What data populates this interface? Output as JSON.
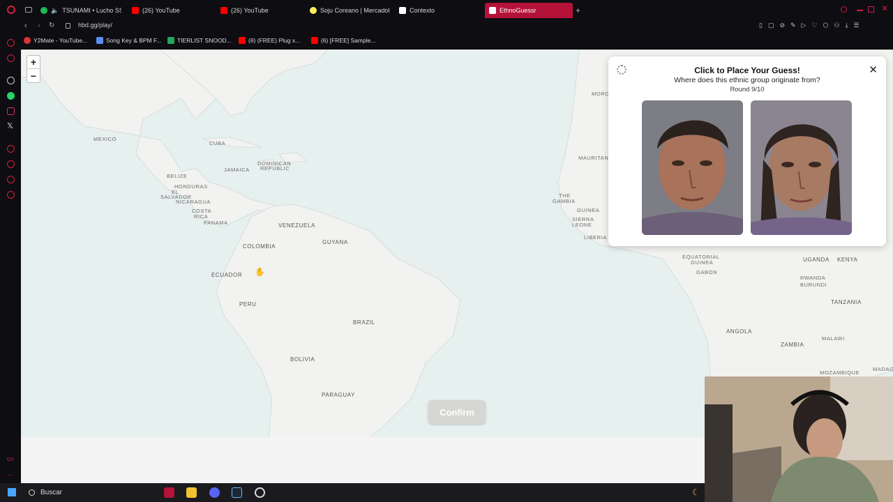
{
  "tabs": [
    {
      "label": "TSUNAMI • Lucho SSJ",
      "favicon_color": "#1db954"
    },
    {
      "label": "(26) YouTube",
      "favicon_color": "#ff0000"
    },
    {
      "label": "(26) YouTube",
      "favicon_color": "#ff0000"
    },
    {
      "label": "Soju Coreano | MercadoLi...",
      "favicon_color": "#fff159"
    },
    {
      "label": "Contexto",
      "favicon_color": "#ffffff"
    },
    {
      "label": "EthnoGuessr",
      "favicon_color": "#ffffff",
      "active": true
    }
  ],
  "address": {
    "url": "hbd.gg/play/"
  },
  "bookmarks": [
    {
      "label": "Y2Mate - YouTube...",
      "favicon_color": "#d33"
    },
    {
      "label": "Song Key & BPM F...",
      "favicon_color": "#5b8def"
    },
    {
      "label": "TIERLIST SNOOD...",
      "favicon_color": "#23a55a"
    },
    {
      "label": "(6) (FREE) Plug x...",
      "favicon_color": "#ff0000"
    },
    {
      "label": "(6) [FREE] Sample...",
      "favicon_color": "#ff0000"
    }
  ],
  "map": {
    "labels": {
      "mexico": "MEXICO",
      "cuba": "CUBA",
      "jamaica": "JAMAICA",
      "dominican": "DOMINICAN",
      "republic": "REPUBLIC",
      "belize": "BELIZE",
      "honduras": "HONDURAS",
      "el": "EL",
      "salvador": "SALVADOR",
      "nicaragua": "NICARAGUA",
      "costa": "COSTA",
      "rica": "RICA",
      "panama": "PANAMA",
      "venezuela": "VENEZUELA",
      "colombia": "COLOMBIA",
      "guyana": "GUYANA",
      "ecuador": "ECUADOR",
      "peru": "PERU",
      "brazil": "BRAZIL",
      "bolivia": "BOLIVIA",
      "paraguay": "PARAGUAY",
      "moroc": "MORO",
      "mauritan": "MAURITAN",
      "the": "THE",
      "gambia": "GAMBIA",
      "guinea": "GUINEA",
      "sierra": "SIERRA",
      "leone": "LEONE",
      "liberia": "LIBERIA",
      "equatorial": "EQUATORIAL",
      "eq_guinea": "GUINEA",
      "gabon": "GABON",
      "uganda": "UGANDA",
      "kenya": "KENYA",
      "rwanda": "RWANDA",
      "burundi": "BURUNDI",
      "tanzania": "TANZANIA",
      "angola": "ANGOLA",
      "malawi": "MALAWI",
      "zambia": "ZAMBIA",
      "mozambique": "MOZAMBIQUE",
      "madag": "MADAG"
    },
    "zoom_in": "+",
    "zoom_out": "−",
    "confirm_label": "Confirm"
  },
  "panel": {
    "title": "Click to Place Your Guess!",
    "subtitle": "Where does this ethnic group originate from?",
    "round": "Round 9/10",
    "close": "✕"
  },
  "taskbar": {
    "search_placeholder": "Buscar"
  },
  "colors": {
    "accent": "#b5123a",
    "map_water": "#e6f0ef",
    "map_land": "#f2f2f0"
  }
}
